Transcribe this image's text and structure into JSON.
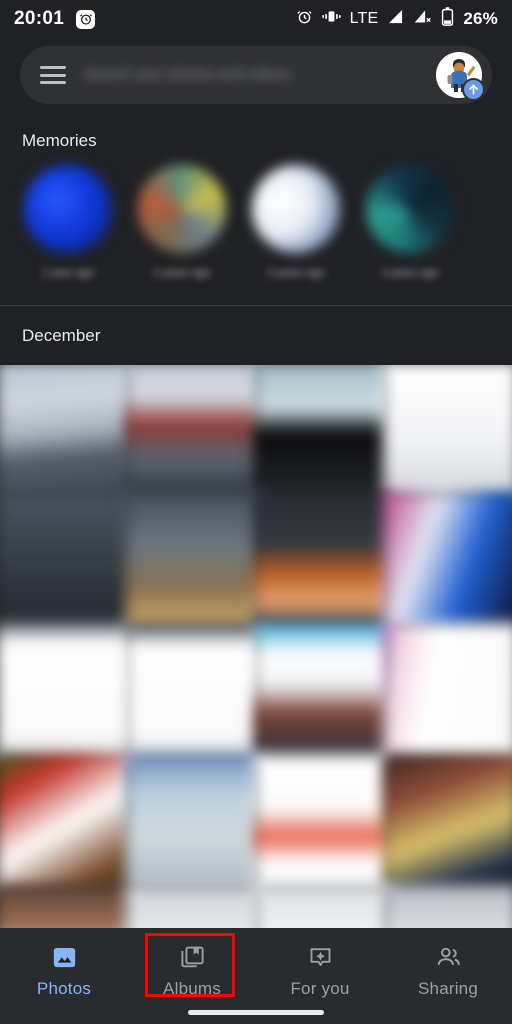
{
  "status_bar": {
    "time": "20:01",
    "alarm_icon": "alarm-clock-icon",
    "vibrate_icon": "vibrate-icon",
    "network_type": "LTE",
    "signal_icon": "signal-bars-icon",
    "signal_off_icon": "signal-no-service-icon",
    "battery_icon": "battery-icon",
    "battery_percent": "26%"
  },
  "search": {
    "menu_icon": "hamburger-menu-icon",
    "placeholder": "Search your photos and videos",
    "value": "",
    "avatar_name": "account-avatar",
    "upload_badge_icon": "upload-arrow-icon"
  },
  "memories": {
    "title": "Memories",
    "items": [
      {
        "label": "1 year ago",
        "thumb": "memory-thumb-1"
      },
      {
        "label": "2 years ago",
        "thumb": "memory-thumb-2"
      },
      {
        "label": "3 years ago",
        "thumb": "memory-thumb-3"
      },
      {
        "label": "4 years ago",
        "thumb": "memory-thumb-4"
      }
    ]
  },
  "timeline": {
    "month_header": "December",
    "photo_count": 20
  },
  "bottom_nav": {
    "items": [
      {
        "label": "Photos",
        "icon": "photos-image-icon",
        "active": true
      },
      {
        "label": "Albums",
        "icon": "albums-book-icon",
        "active": false
      },
      {
        "label": "For you",
        "icon": "for-you-sparkle-icon",
        "active": false
      },
      {
        "label": "Sharing",
        "icon": "sharing-people-icon",
        "active": false
      }
    ]
  },
  "annotation": {
    "target": "Albums",
    "color": "#ff0000"
  },
  "colors": {
    "background": "#202124",
    "surface": "#303134",
    "nav_surface": "#2a2b2e",
    "accent": "#8ab4f8",
    "text_primary": "#e8eaed",
    "text_secondary": "#9aa0a6",
    "badge_blue": "#6b9ae8"
  }
}
